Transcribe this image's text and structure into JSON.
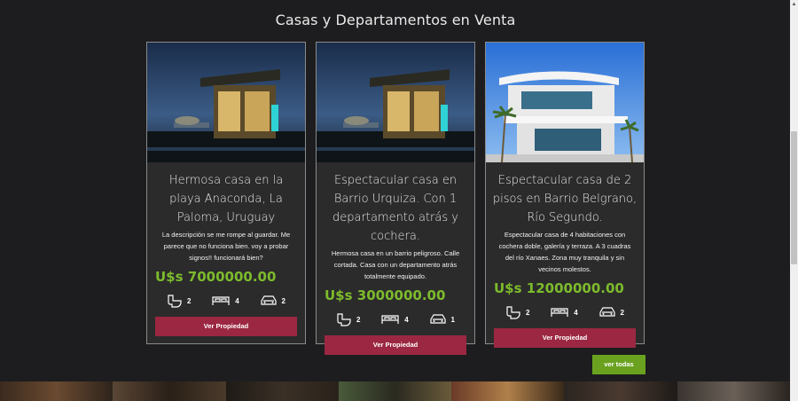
{
  "section_title": "Casas y Departamentos en Venta",
  "cards": [
    {
      "title": "Hermosa casa en la playa Anaconda, La Paloma, Uruguay",
      "description": "La descripción se me rompe al guardar. Me parece que no funciona bien. voy a probar signos!! funcionará bien?",
      "price": "U$s 7000000.00",
      "bathrooms": "2",
      "bedrooms": "4",
      "garages": "2",
      "button_label": "Ver Propiedad",
      "image": "night-house-icon"
    },
    {
      "title": "Espectacular casa en Barrio Urquiza. Con 1 departamento atrás y cochera.",
      "description": "Hermosa casa en un barrio peligroso. Calle cortada. Casa con un departamento atrás totalmente equipado.",
      "price": "U$s 3000000.00",
      "bathrooms": "2",
      "bedrooms": "4",
      "garages": "1",
      "button_label": "Ver Propiedad",
      "image": "night-house-icon"
    },
    {
      "title": "Espectacular casa de 2 pisos en Barrio Belgrano, Río Segundo.",
      "description": "Espectacular casa de 4 habitaciones con cochera doble, galería y terraza. A 3 cuadras del río Xanaes. Zona muy tranquila y sin vecinos molestos.",
      "price": "U$s 12000000.00",
      "bathrooms": "2",
      "bedrooms": "4",
      "garages": "2",
      "button_label": "Ver Propiedad",
      "image": "modern-house-icon"
    }
  ],
  "see_all_label": "ver todas",
  "colors": {
    "background": "#1d1d1f",
    "card": "#2b2b2b",
    "price": "#7dbb2c",
    "button": "#9b2742",
    "see_all": "#6aa21f"
  }
}
